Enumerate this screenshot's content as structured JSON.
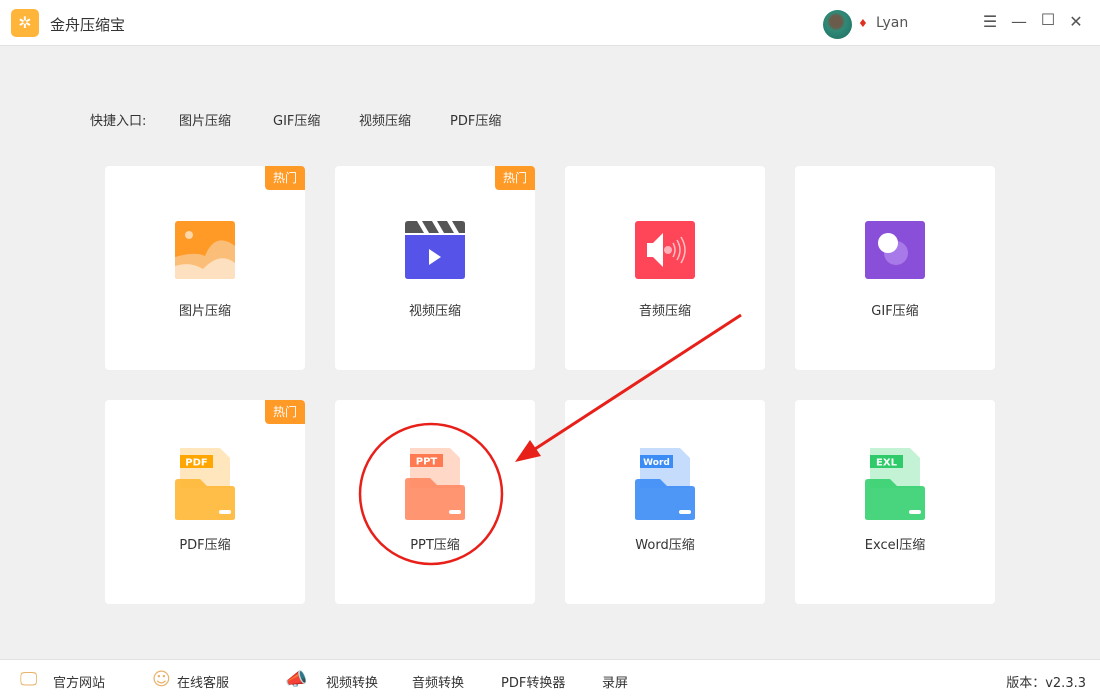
{
  "app": {
    "title": "金舟压缩宝",
    "user": "Lyan"
  },
  "quick": {
    "label": "快捷入口:",
    "links": [
      "图片压缩",
      "GIF压缩",
      "视频压缩",
      "PDF压缩"
    ]
  },
  "badge": "热门",
  "cards": [
    {
      "label": "图片压缩",
      "hot": true,
      "color": "#ff9a26"
    },
    {
      "label": "视频压缩",
      "hot": true,
      "color": "#5654e8"
    },
    {
      "label": "音频压缩",
      "hot": false,
      "color": "#ff4558"
    },
    {
      "label": "GIF压缩",
      "hot": false,
      "color": "#8a4fd8"
    },
    {
      "label": "PDF压缩",
      "hot": true,
      "tag": "PDF",
      "color": "#ffa600"
    },
    {
      "label": "PPT压缩",
      "hot": false,
      "tag": "PPT",
      "color": "#ff7a50"
    },
    {
      "label": "Word压缩",
      "hot": false,
      "tag": "Word",
      "color": "#3b8cf5"
    },
    {
      "label": "Excel压缩",
      "hot": false,
      "tag": "EXL",
      "color": "#2fcb6a"
    }
  ],
  "footer": {
    "items": [
      "官方网站",
      "在线客服",
      "视频转换",
      "音频转换",
      "PDF转换器",
      "录屏"
    ],
    "version": "版本：v2.3.3"
  },
  "annotation_color": "#e8201a"
}
